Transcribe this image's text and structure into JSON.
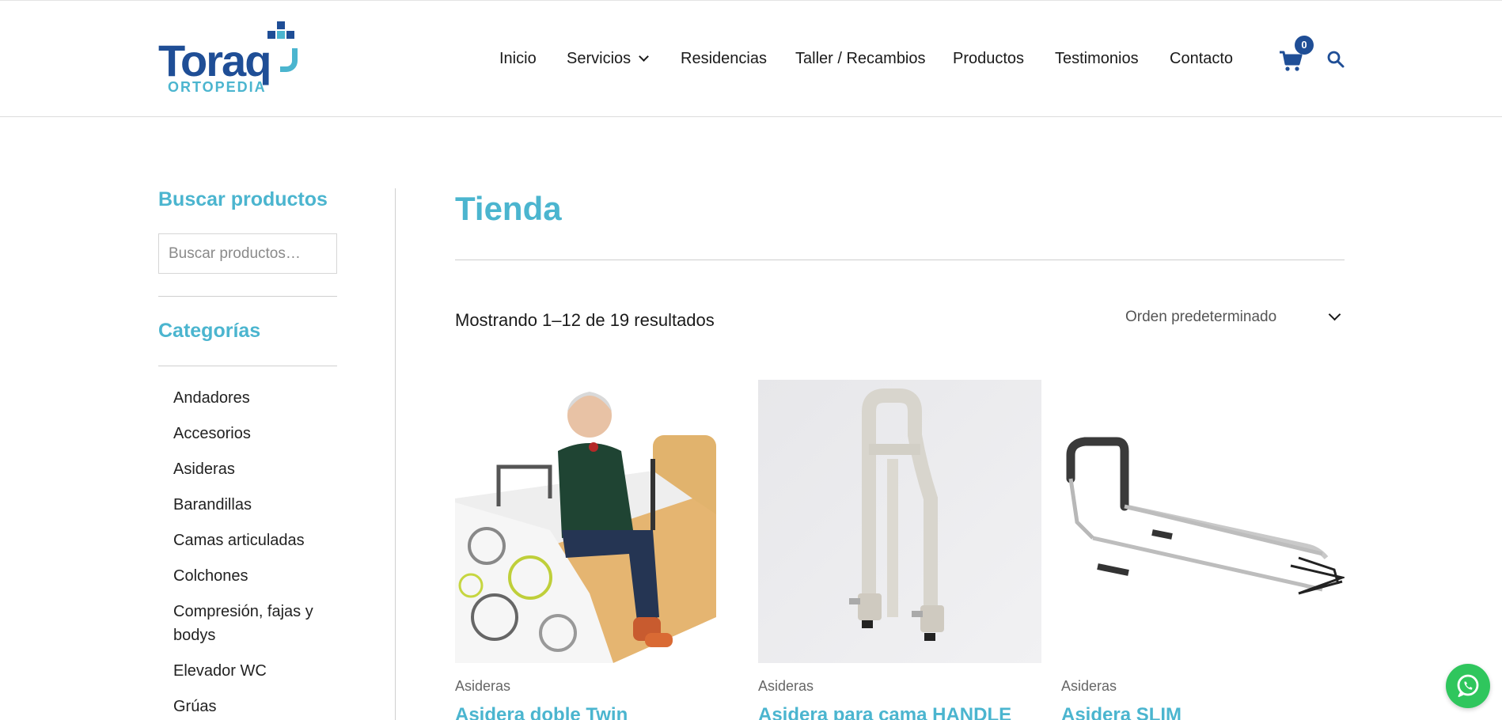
{
  "brand": {
    "name": "Toraq",
    "sub": "ORTOPEDIA",
    "primary_color": "#1f4e96",
    "accent_color": "#4bb5cf"
  },
  "nav": {
    "items": [
      {
        "label": "Inicio"
      },
      {
        "label": "Servicios",
        "has_dropdown": true
      },
      {
        "label": "Residencias"
      },
      {
        "label": "Taller / Recambios"
      },
      {
        "label": "Productos"
      },
      {
        "label": "Testimonios"
      },
      {
        "label": "Contacto"
      }
    ],
    "cart_count": "0",
    "cart_icon": "cart-icon",
    "search_icon": "search-icon"
  },
  "sidebar": {
    "search_title": "Buscar productos",
    "search_placeholder": "Buscar productos…",
    "categories_title": "Categorías",
    "categories": [
      "Andadores",
      "Accesorios",
      "Asideras",
      "Barandillas",
      "Camas articuladas",
      "Colchones",
      "Compresión, fajas y bodys",
      "Elevador WC",
      "Grúas"
    ]
  },
  "main": {
    "title": "Tienda",
    "result_count": "Mostrando 1–12 de 19 resultados",
    "ordering": "Orden predeterminado",
    "products": [
      {
        "category": "Asideras",
        "name": "Asidera doble Twin"
      },
      {
        "category": "Asideras",
        "name": "Asidera para cama HANDLE"
      },
      {
        "category": "Asideras",
        "name": "Asidera SLIM"
      }
    ]
  },
  "floating": {
    "whatsapp_icon": "whatsapp-icon",
    "whatsapp_color": "#2fc65d"
  }
}
